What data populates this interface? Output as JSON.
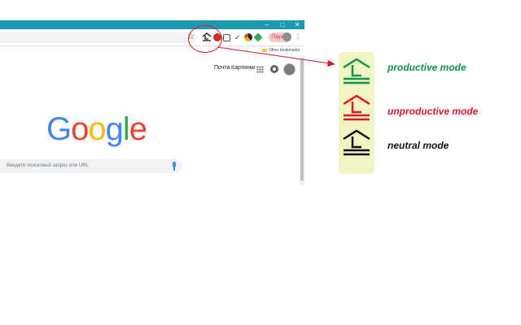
{
  "browser": {
    "window_controls": [
      "–",
      "□",
      "✕"
    ],
    "user_pill_text": "Пауза",
    "bookmarks": {
      "other_bookmarks": "Other bookmarks"
    }
  },
  "google_page": {
    "header_links": [
      "Почта",
      "Картинки"
    ],
    "logo_letters": [
      {
        "char": "G",
        "color": "#4285f4"
      },
      {
        "char": "o",
        "color": "#ea4335"
      },
      {
        "char": "o",
        "color": "#fbbc05"
      },
      {
        "char": "g",
        "color": "#4285f4"
      },
      {
        "char": "l",
        "color": "#34a853"
      },
      {
        "char": "e",
        "color": "#ea4335"
      }
    ],
    "search_placeholder": "Введите поисковый запрос или URL"
  },
  "legend": {
    "productive": {
      "label": "productive mode",
      "color": "#12934b"
    },
    "unproductive": {
      "label": "unproductive mode",
      "color": "#e0142a"
    },
    "neutral": {
      "label": "neutral mode",
      "color": "#111111"
    }
  },
  "icons": {
    "star": "bookmark-star-icon",
    "productivity_extension": "house-mode-icon",
    "apps": "apps-grid-icon",
    "notifications": "notifications-icon",
    "mic": "microphone-icon"
  }
}
